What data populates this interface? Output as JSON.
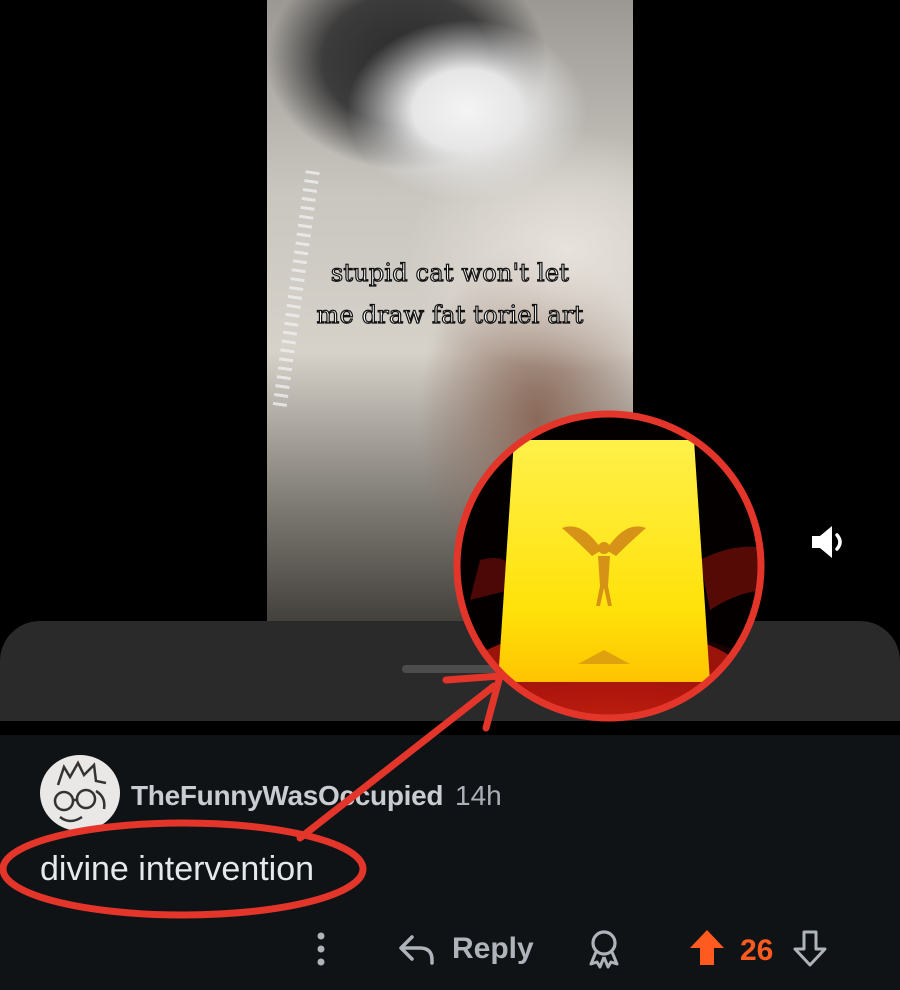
{
  "video": {
    "caption_lines": [
      "stupid cat won't let",
      "me draw fat toriel art"
    ],
    "speaker_icon": "speaker-icon"
  },
  "comment": {
    "username": "TheFunnyWasOccupied",
    "timestamp": "14h",
    "body": "divine intervention"
  },
  "actions": {
    "more_icon": "vertical-ellipsis-icon",
    "reply_icon": "reply-arrow-icon",
    "reply_label": "Reply",
    "award_icon": "award-icon",
    "upvote_icon": "upvote-arrow-icon",
    "score": "26",
    "downvote_icon": "downvote-arrow-icon"
  },
  "colors": {
    "annotation_red": "#e4352b",
    "upvote_orange": "#ff5a1f",
    "panel_bg": "#0f1316",
    "sheet_bg": "#2a2a2a"
  }
}
